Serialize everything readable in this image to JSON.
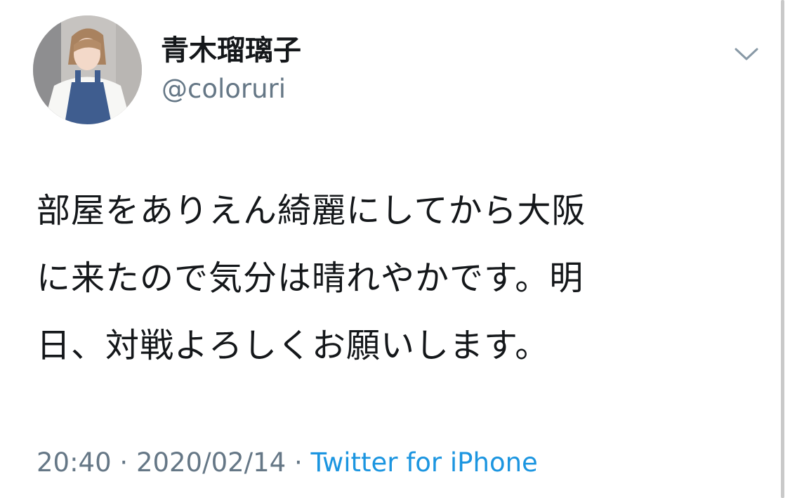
{
  "tweet": {
    "display_name": "青木瑠璃子",
    "handle": "@coloruri",
    "text_lines": [
      "部屋をありえん綺麗にしてから大阪",
      "に来たので気分は晴れやかです。明",
      "日、対戦よろしくお願いします。"
    ],
    "time": "20:40",
    "separator": " · ",
    "date": "2020/02/14",
    "source": "Twitter for iPhone",
    "icons": {
      "menu": "chevron-down-icon",
      "avatar": "profile-photo"
    }
  },
  "colors": {
    "text": "#14171a",
    "secondary": "#657786",
    "link": "#1b95e0"
  }
}
